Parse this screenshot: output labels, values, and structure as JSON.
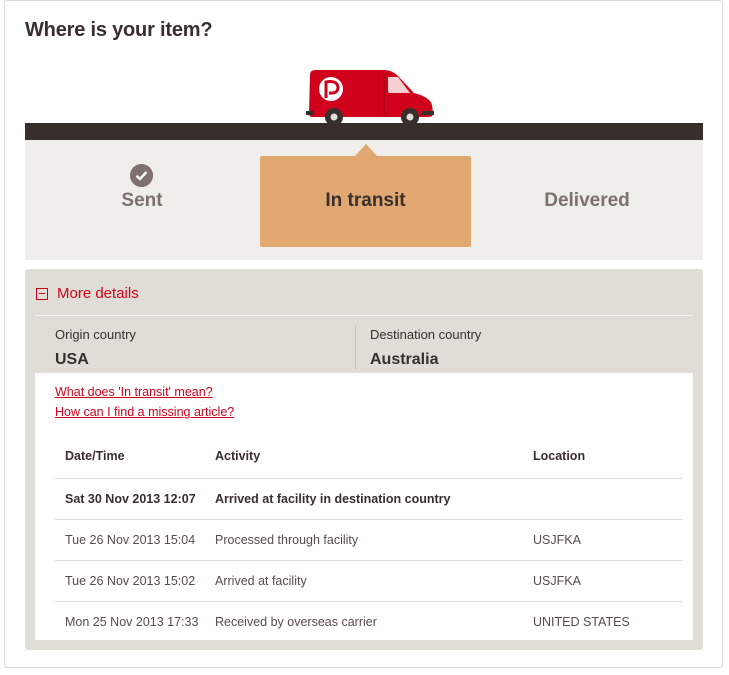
{
  "page": {
    "title": "Where is your item?"
  },
  "status": {
    "steps": [
      {
        "label": "Sent",
        "state": "done"
      },
      {
        "label": "In transit",
        "state": "current"
      },
      {
        "label": "Delivered",
        "state": "pending"
      }
    ]
  },
  "details": {
    "toggle_label": "More details",
    "origin": {
      "label": "Origin country",
      "value": "USA"
    },
    "destination": {
      "label": "Destination country",
      "value": "Australia"
    },
    "links": [
      "What does 'In transit' mean?",
      "How can I find a missing article?"
    ],
    "table": {
      "headers": [
        "Date/Time",
        "Activity",
        "Location"
      ],
      "rows": [
        {
          "datetime": "Sat 30 Nov 2013 12:07",
          "activity": "Arrived at facility in destination country",
          "location": ""
        },
        {
          "datetime": "Tue 26 Nov 2013 15:04",
          "activity": "Processed through facility",
          "location": "USJFKA"
        },
        {
          "datetime": "Tue 26 Nov 2013 15:02",
          "activity": "Arrived at facility",
          "location": "USJFKA"
        },
        {
          "datetime": "Mon 25 Nov 2013 17:33",
          "activity": "Received by overseas carrier",
          "location": "UNITED STATES"
        }
      ]
    }
  },
  "colors": {
    "accent_red": "#d0021b",
    "in_transit": "#e2a872",
    "dark": "#382f2d",
    "muted": "#7d706d"
  },
  "icons": [
    "van-icon",
    "check-icon",
    "collapse-icon"
  ]
}
